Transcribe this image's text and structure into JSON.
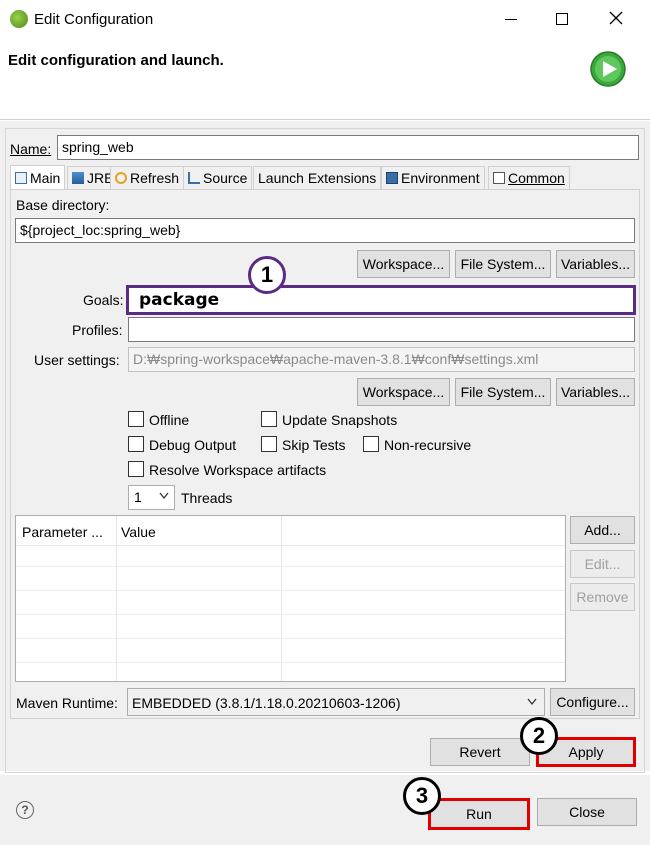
{
  "window": {
    "title": "Edit Configuration",
    "minimize_icon": "minimize-icon",
    "maximize_icon": "maximize-icon",
    "close_icon": "close-icon"
  },
  "header": {
    "heading": "Edit configuration and launch."
  },
  "form": {
    "name_label": "Name:",
    "name_value": "spring_web",
    "tabs": [
      {
        "label": "Main"
      },
      {
        "label": "JRE"
      },
      {
        "label": "Refresh"
      },
      {
        "label": "Source"
      },
      {
        "label": "Launch Extensions"
      },
      {
        "label": "Environment"
      },
      {
        "label": "Common"
      }
    ],
    "base_dir_label": "Base directory:",
    "base_dir_value": "${project_loc:spring_web}",
    "workspace_btn": "Workspace...",
    "filesystem_btn": "File System...",
    "variables_btn": "Variables...",
    "goals_label": "Goals:",
    "goals_value": "package",
    "profiles_label": "Profiles:",
    "profiles_value": "",
    "user_settings_label": "User settings:",
    "user_settings_value": "D:₩spring-workspace₩apache-maven-3.8.1₩conf₩settings.xml",
    "workspace_btn2": "Workspace...",
    "filesystem_btn2": "File System...",
    "variables_btn2": "Variables...",
    "offline": "Offline",
    "update_snapshots": "Update Snapshots",
    "debug_output": "Debug Output",
    "skip_tests": "Skip Tests",
    "non_recursive": "Non-recursive",
    "resolve_workspace": "Resolve Workspace artifacts",
    "threads_value": "1",
    "threads_label": "Threads",
    "params_col1": "Parameter ...",
    "params_col2": "Value",
    "add_btn": "Add...",
    "edit_btn": "Edit...",
    "remove_btn": "Remove",
    "maven_runtime_label": "Maven Runtime:",
    "maven_runtime_value": "EMBEDDED (3.8.1/1.18.0.20210603-1206)",
    "configure_btn": "Configure...",
    "revert_btn": "Revert",
    "apply_btn": "Apply"
  },
  "footer": {
    "run_btn": "Run",
    "close_btn": "Close"
  },
  "annotations": {
    "step1": "1",
    "step2": "2",
    "step3": "3"
  },
  "colors": {
    "goals_border": "#5b2a86",
    "highlight_red": "#e00000",
    "run_icon_green": "#3aa83a"
  }
}
